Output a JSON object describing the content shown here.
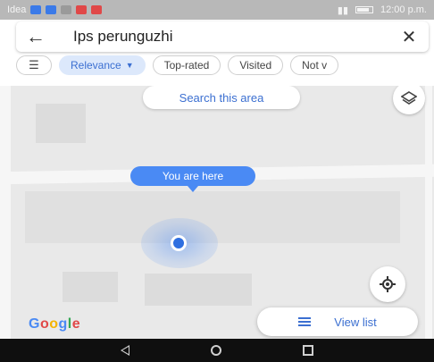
{
  "status_bar": {
    "carrier": "Idea",
    "time": "12:00 p.m.",
    "chip_colors": [
      "#3b7ae8",
      "#3b7ae8",
      "#9a9a9a",
      "#e04848",
      "#e04848"
    ]
  },
  "search": {
    "query": "Ips perunguzhi",
    "back_icon": "arrow-left-icon",
    "clear_icon": "close-icon"
  },
  "filters": {
    "filter_icon": "filter-sliders-icon",
    "chips": [
      "Relevance",
      "Top-rated",
      "Visited",
      "Not v"
    ],
    "active_index": 0
  },
  "map": {
    "search_area_label": "Search this area",
    "you_are_here_label": "You are here",
    "layers_icon": "layers-icon",
    "my_location_icon": "my-location-icon",
    "view_list_label": "View list",
    "view_list_icon": "list-icon",
    "google_logo_text": [
      "G",
      "o",
      "o",
      "g",
      "l",
      "e"
    ],
    "google_logo_colors": [
      "#4a8af4",
      "#e04848",
      "#f4b400",
      "#4a8af4",
      "#34a853",
      "#e04848"
    ],
    "accent_color": "#3b6fd1"
  },
  "nav_bar": {
    "icons": [
      "back-triangle-icon",
      "home-circle-icon",
      "recents-square-icon"
    ]
  }
}
